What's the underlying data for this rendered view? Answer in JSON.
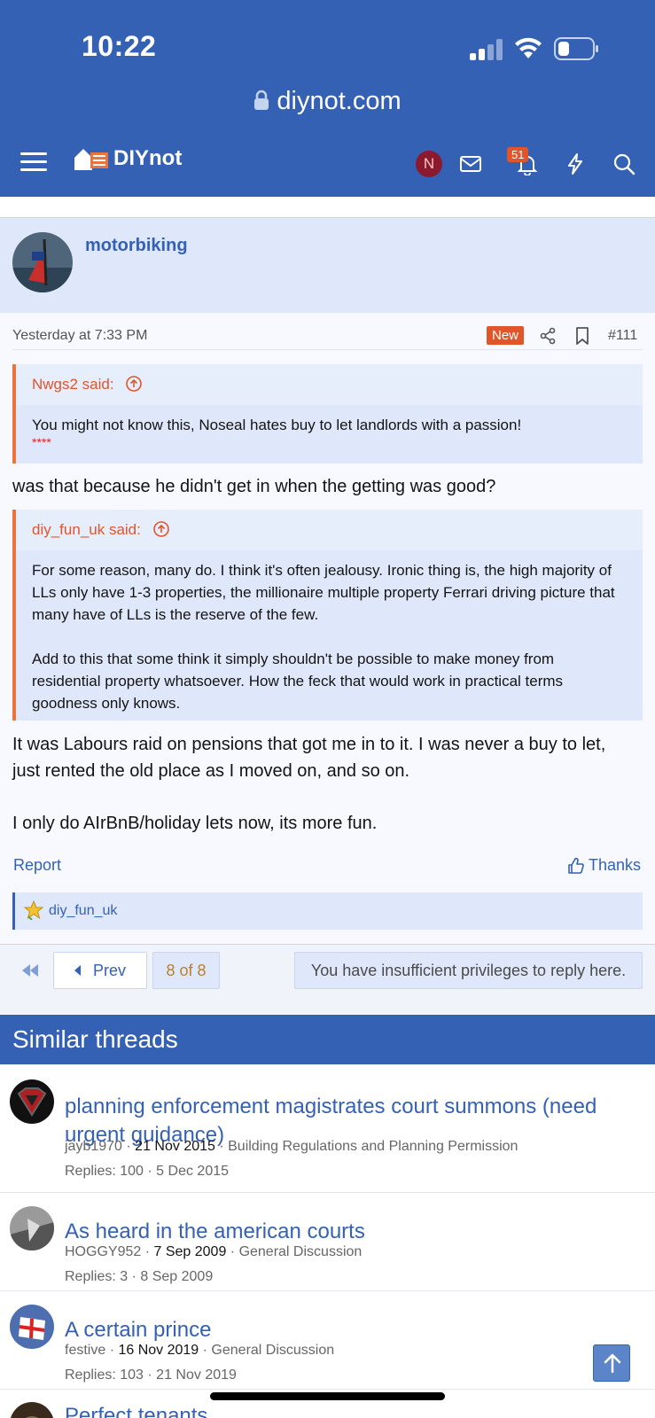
{
  "status_bar": {
    "time": "10:22"
  },
  "browser": {
    "url": "diynot.com"
  },
  "nav": {
    "logo_text": "DIYnot",
    "avatar_initial": "N",
    "notification_count": "51"
  },
  "post": {
    "username": "motorbiking",
    "date": "Yesterday at 7:33 PM",
    "new_label": "New",
    "post_number": "#111",
    "quote1": {
      "author": "Nwgs2 said:",
      "text": "You might not know this, Noseal hates buy to let landlords with a passion!",
      "censored": "****"
    },
    "reply1": "was that because he didn't get in when the getting was good?",
    "quote2": {
      "author": "diy_fun_uk said:",
      "para1": "For some reason, many do. I think it's often jealousy. Ironic thing is, the high majority of LLs only have 1-3 properties, the millionaire multiple property Ferrari driving picture that many have of LLs is the reserve of the few.",
      "para2": "Add to this that some think it simply shouldn't be possible to make money from residential property whatsoever. How the feck that would work in practical terms goodness only knows."
    },
    "reply2": "It was Labours raid on pensions that got me in to it. I was never a buy to let, just rented the old place as I moved on, and so on.",
    "reply3": "I only do AIrBnB/holiday lets now, its more fun.",
    "report_label": "Report",
    "thanks_label": "Thanks",
    "reaction_user": "diy_fun_uk"
  },
  "pagination": {
    "prev_label": "Prev",
    "page_label": "8 of 8",
    "no_reply_message": "You have insufficient privileges to reply here."
  },
  "similar_threads": {
    "heading": "Similar threads",
    "items": [
      {
        "title": "planning enforcement magistrates court summons (need urgent guidance)",
        "author": "jayb1970",
        "date": "21 Nov 2015",
        "forum": "Building Regulations and Planning Permission",
        "replies": "Replies: 100",
        "last": "5 Dec 2015"
      },
      {
        "title": "As heard in the american courts",
        "author": "HOGGY952",
        "date": "7 Sep 2009",
        "forum": "General Discussion",
        "replies": "Replies: 3",
        "last": "8 Sep 2009"
      },
      {
        "title": "A certain prince",
        "author": "festive",
        "date": "16 Nov 2019",
        "forum": "General Discussion",
        "replies": "Replies: 103",
        "last": "21 Nov 2019"
      },
      {
        "title": "Perfect tenants"
      }
    ]
  },
  "colors": {
    "brand_blue": "#3461b4",
    "accent_orange": "#e0552a",
    "quote_bg": "#dfe8fa"
  }
}
